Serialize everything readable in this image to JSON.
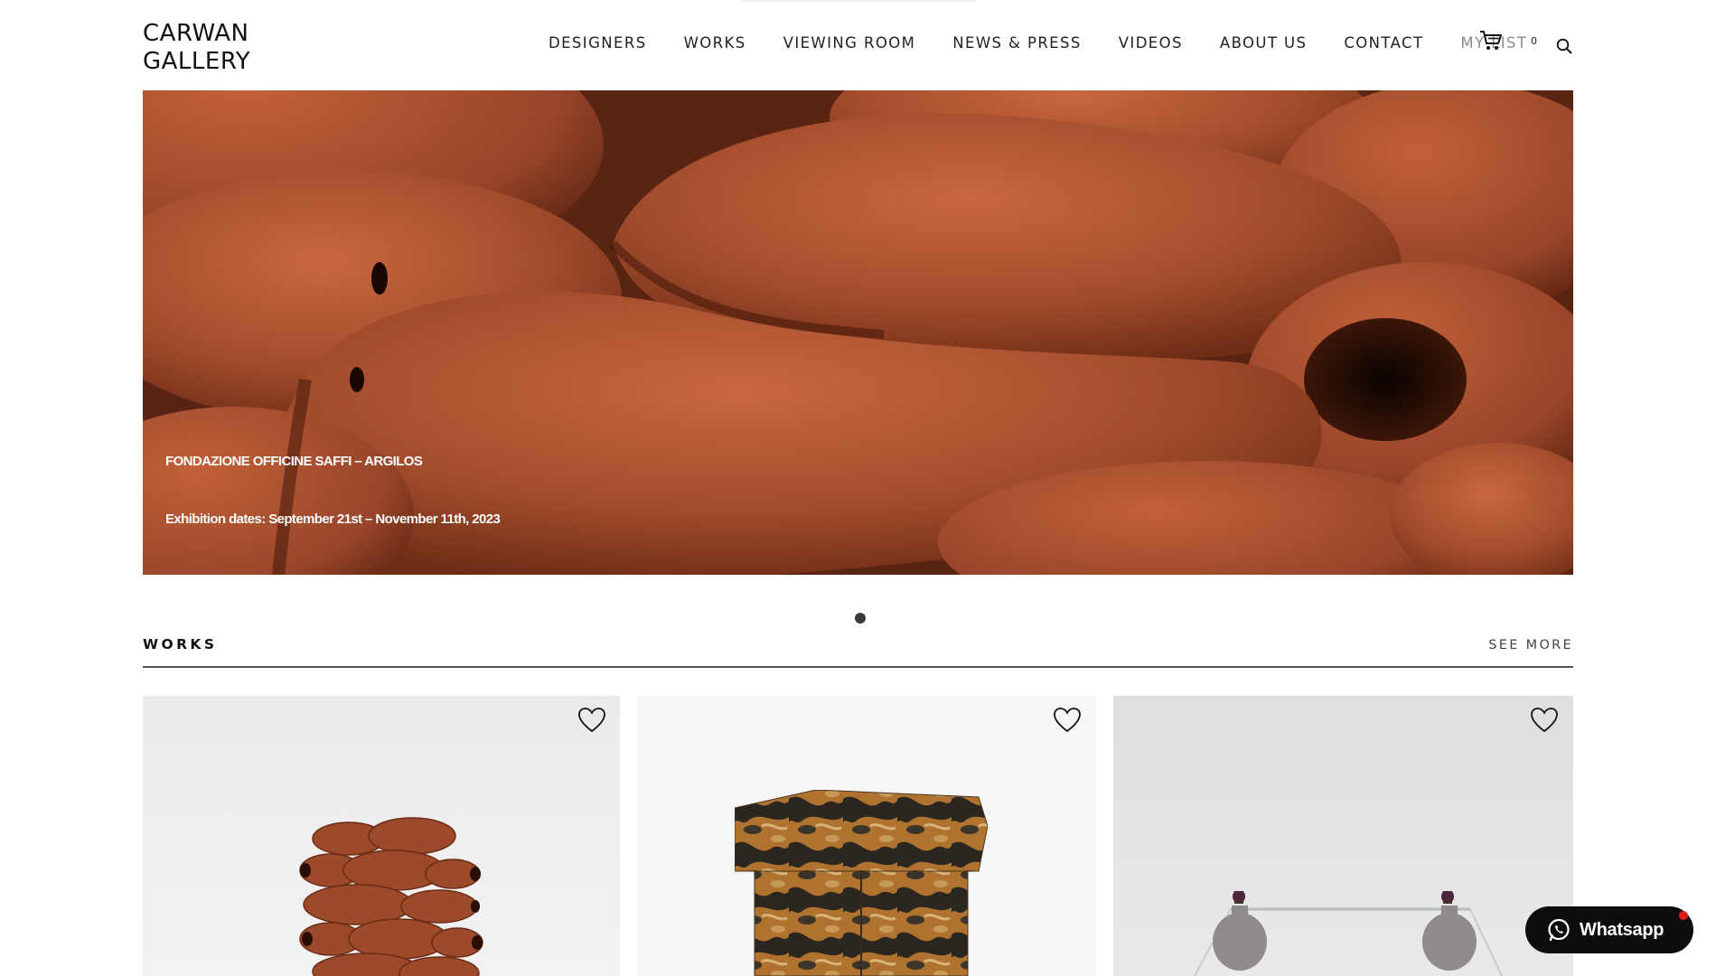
{
  "header": {
    "logo_line1": "CARWAN",
    "logo_line2": "GALLERY",
    "nav": [
      "DESIGNERS",
      "WORKS",
      "VIEWING ROOM",
      "NEWS & PRESS",
      "VIDEOS",
      "ABOUT US",
      "CONTACT",
      "MY LIST"
    ],
    "cart_count": "0"
  },
  "hero": {
    "title": "FONDAZIONE OFFICINE SAFFI – ARGILOS",
    "dates": "Exhibition dates: September 21st – November 11th, 2023",
    "slides": 1
  },
  "works": {
    "heading": "WORKS",
    "see_more": "SEE MORE"
  },
  "whatsapp": {
    "label": "Whatsapp"
  },
  "colors": {
    "hero_clay": "#a44e2f",
    "notification_dot": "#e21b1b",
    "text": "#1a1a1a"
  }
}
